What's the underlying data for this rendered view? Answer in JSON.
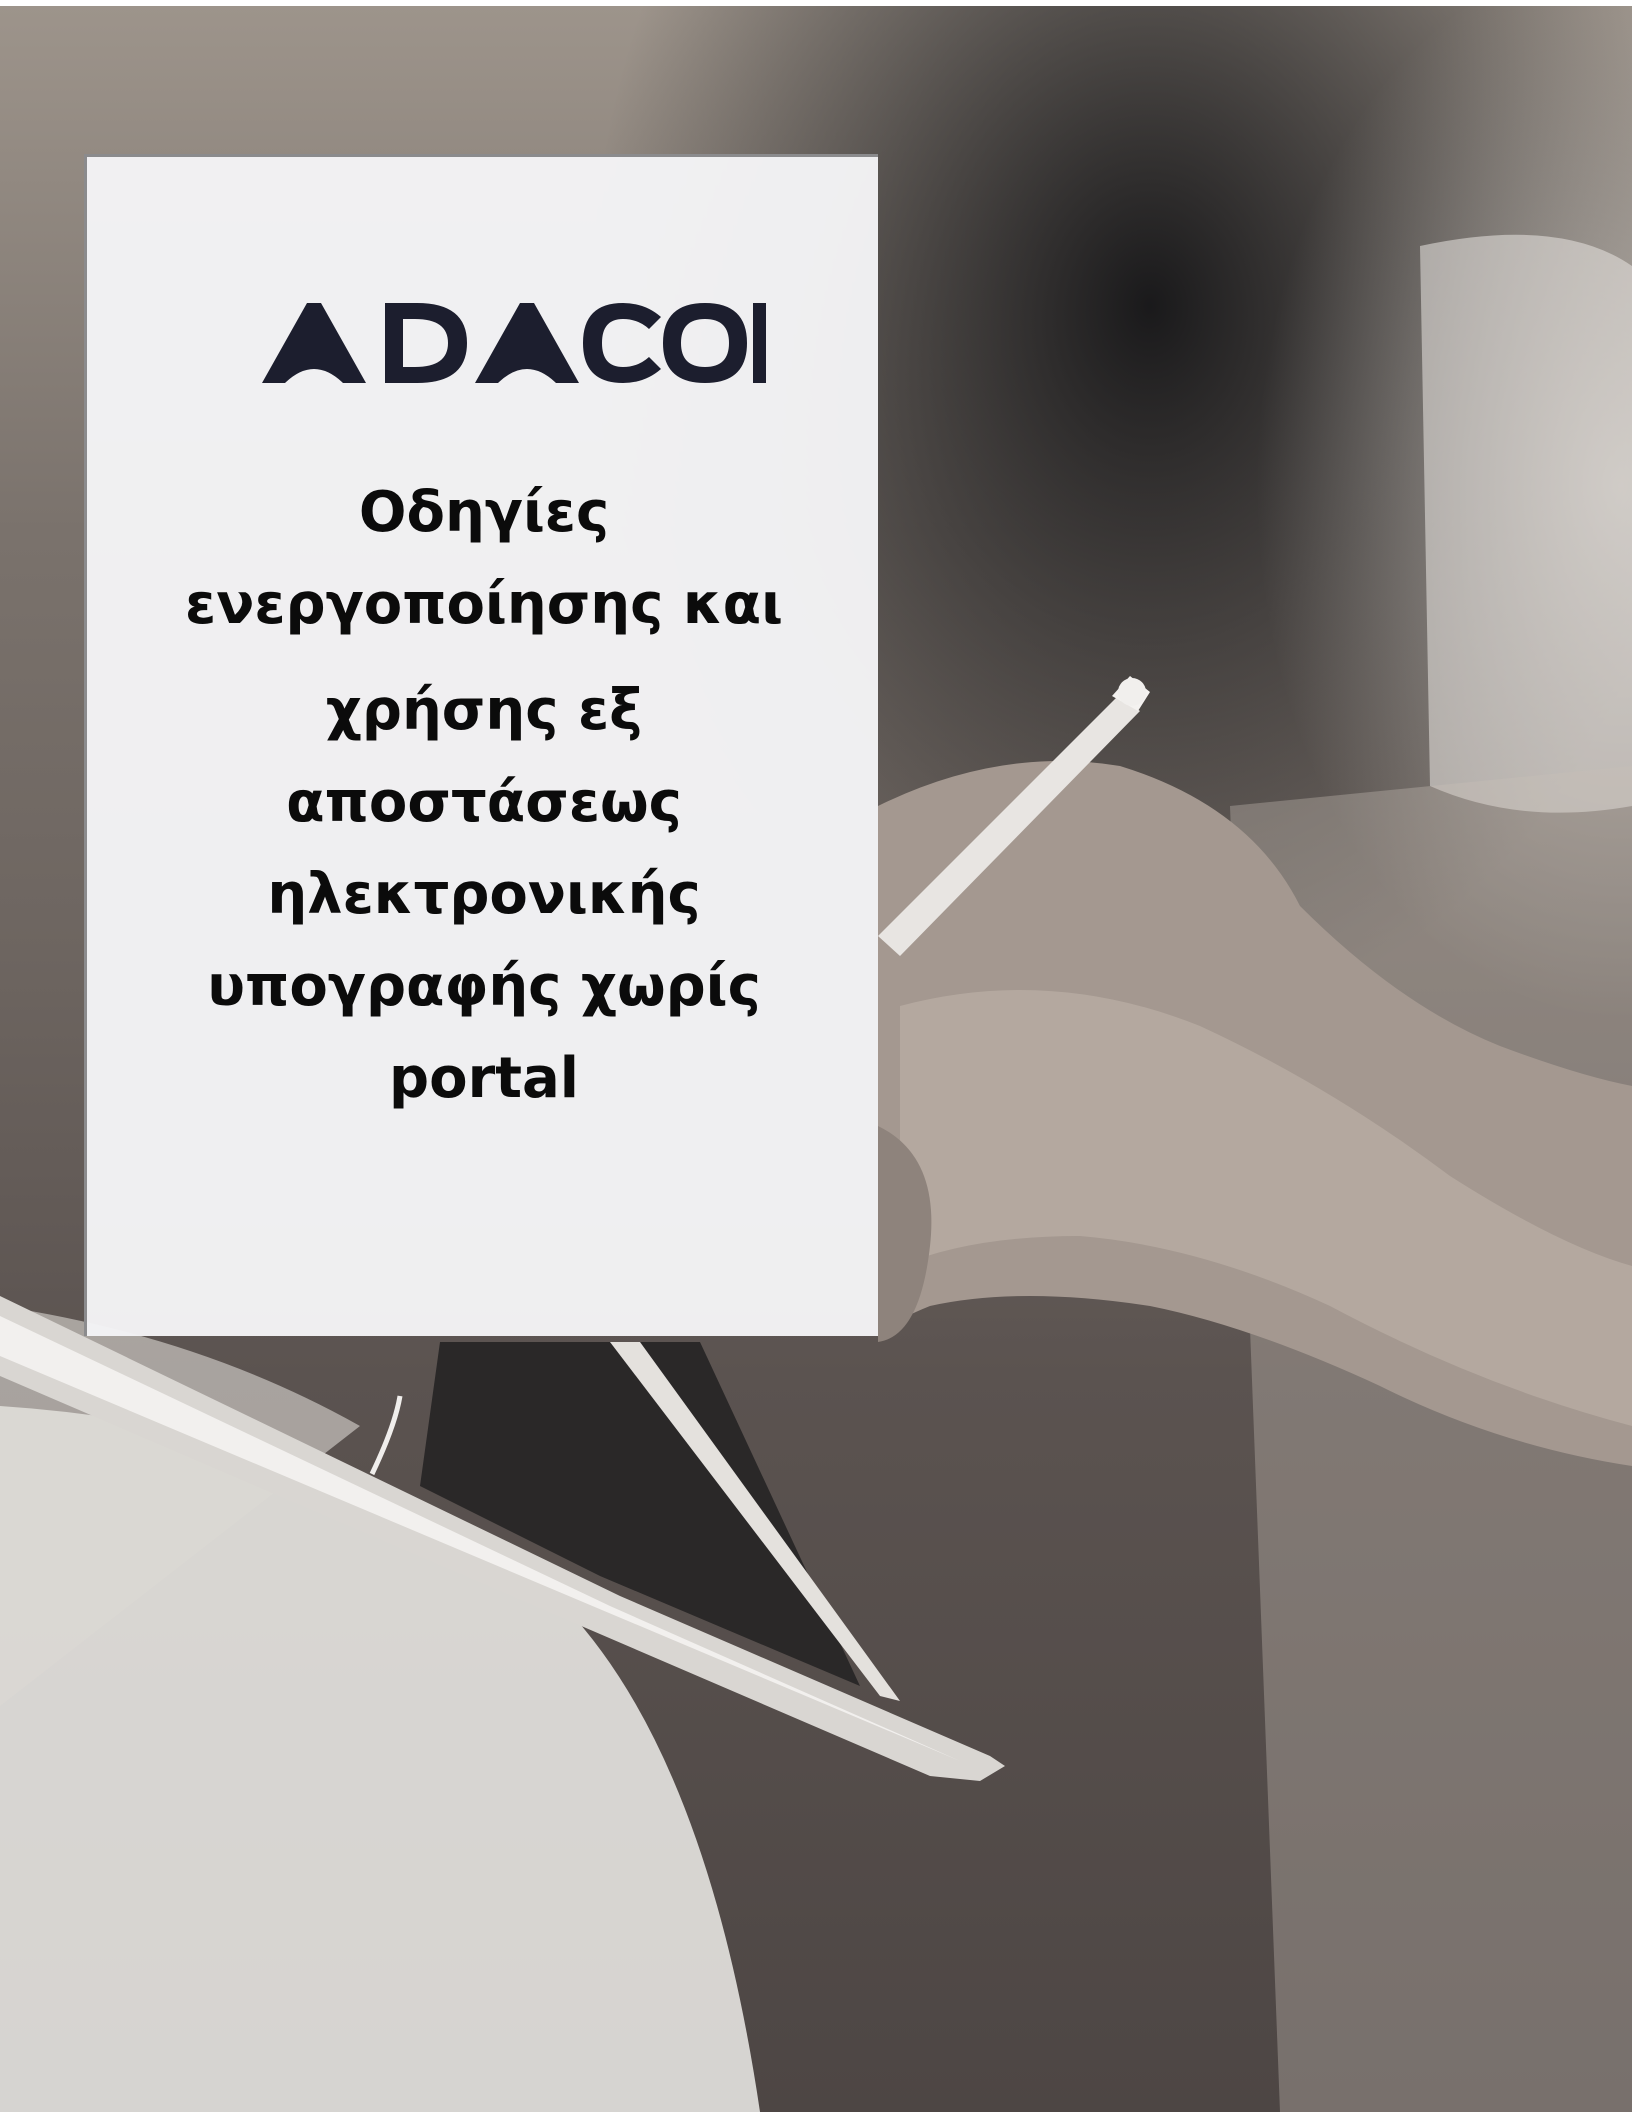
{
  "logo": {
    "text": "ADACOM",
    "color": "#1c1e2e"
  },
  "title": {
    "lines": [
      "Οδηγίες",
      "ενεργοποίησης και",
      "χρήσης εξ",
      "αποστάσεως",
      "ηλεκτρονικής",
      "υπογραφής χωρίς",
      "portal"
    ]
  }
}
